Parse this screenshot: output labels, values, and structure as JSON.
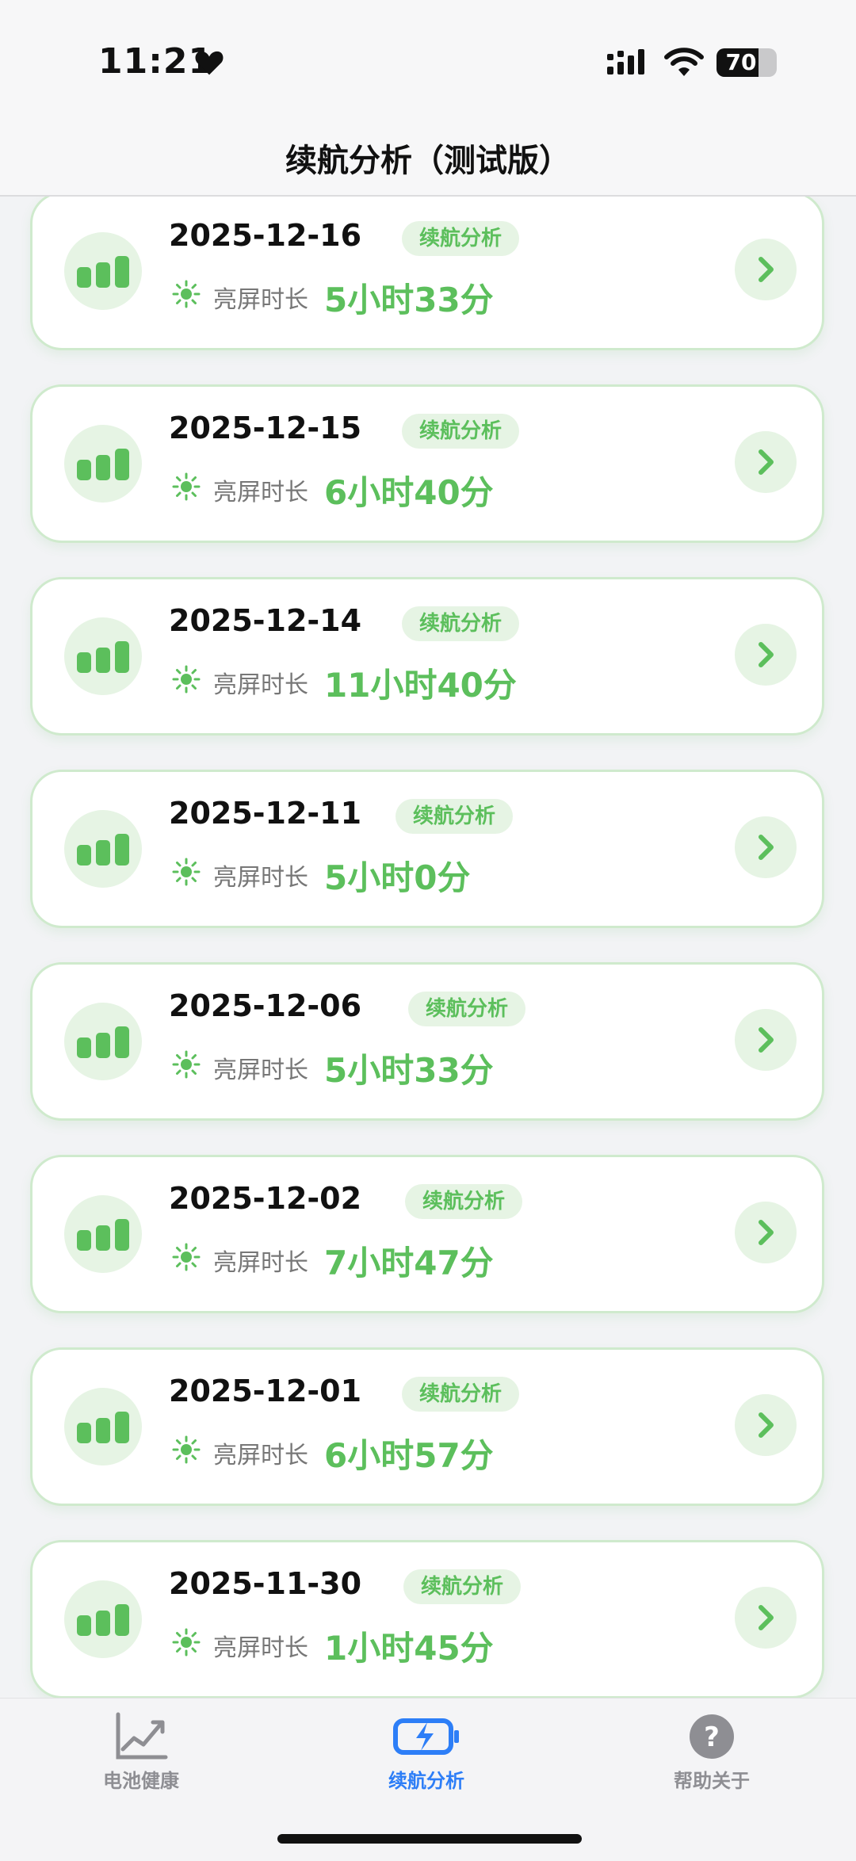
{
  "status_bar": {
    "time": "11:21",
    "battery_level": "70",
    "battery_percent": 70,
    "icons": [
      "heart-icon",
      "cellular-signal-icon",
      "wifi-icon",
      "battery-icon"
    ]
  },
  "header": {
    "title": "续航分析（测试版）"
  },
  "list": {
    "tag_label": "续航分析",
    "screen_time_label": "亮屏时长",
    "items": [
      {
        "date": "2025-12-16",
        "tag": "续航分析",
        "label": "亮屏时长",
        "duration": "5小时33分"
      },
      {
        "date": "2025-12-15",
        "tag": "续航分析",
        "label": "亮屏时长",
        "duration": "6小时40分"
      },
      {
        "date": "2025-12-14",
        "tag": "续航分析",
        "label": "亮屏时长",
        "duration": "11小时40分"
      },
      {
        "date": "2025-12-11",
        "tag": "续航分析",
        "label": "亮屏时长",
        "duration": "5小时0分"
      },
      {
        "date": "2025-12-06",
        "tag": "续航分析",
        "label": "亮屏时长",
        "duration": "5小时33分"
      },
      {
        "date": "2025-12-02",
        "tag": "续航分析",
        "label": "亮屏时长",
        "duration": "7小时47分"
      },
      {
        "date": "2025-12-01",
        "tag": "续航分析",
        "label": "亮屏时长",
        "duration": "6小时57分"
      },
      {
        "date": "2025-11-30",
        "tag": "续航分析",
        "label": "亮屏时长",
        "duration": "1小时45分"
      }
    ]
  },
  "tabbar": {
    "tabs": [
      {
        "label": "电池健康",
        "icon": "chart-icon",
        "active": false
      },
      {
        "label": "续航分析",
        "icon": "battery-charging-icon",
        "active": true
      },
      {
        "label": "帮助关于",
        "icon": "help-icon",
        "active": false
      }
    ]
  },
  "colors": {
    "accent": "#5cbf5c",
    "accent_light": "#e6f4e4",
    "tab_active": "#2d7ef7",
    "tab_inactive": "#8e8e93"
  }
}
